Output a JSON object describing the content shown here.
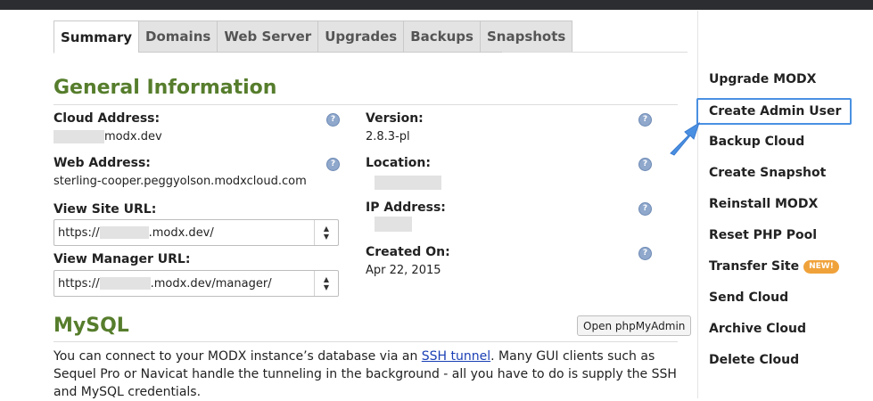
{
  "tabs": [
    "Summary",
    "Domains",
    "Web Server",
    "Upgrades",
    "Backups",
    "Snapshots"
  ],
  "general": {
    "title": "General Information",
    "cloud_address_label": "Cloud Address:",
    "cloud_address_value": "modx.dev",
    "web_address_label": "Web Address:",
    "web_address_value": "sterling-cooper.peggyolson.modxcloud.com",
    "view_site_label": "View Site URL:",
    "view_site_prefix": "https://",
    "view_site_suffix": ".modx.dev/",
    "view_manager_label": "View Manager URL:",
    "view_manager_prefix": "https://",
    "view_manager_suffix": ".modx.dev/manager/",
    "version_label": "Version:",
    "version_value": "2.8.3-pl",
    "location_label": "Location:",
    "ip_label": "IP Address:",
    "created_label": "Created On:",
    "created_value": "Apr 22, 2015",
    "help_glyph": "?"
  },
  "mysql": {
    "title": "MySQL",
    "button": "Open phpMyAdmin",
    "text_before": "You can connect to your MODX instance’s database via an ",
    "link": "SSH tunnel",
    "text_after": ". Many GUI clients such as Sequel Pro or Navicat handle the tunneling in the background - all you have to do is supply the SSH and MySQL credentials."
  },
  "sidebar": {
    "items": [
      "Upgrade MODX",
      "Create Admin User",
      "Backup Cloud",
      "Create Snapshot",
      "Reinstall MODX",
      "Reset PHP Pool",
      "Transfer Site",
      "Send Cloud",
      "Archive Cloud",
      "Delete Cloud"
    ],
    "new_badge": "NEW!"
  },
  "colors": {
    "heading": "#567d2c",
    "highlight": "#4a90e2",
    "badge": "#f0a23a",
    "link": "#1a3fb5"
  }
}
